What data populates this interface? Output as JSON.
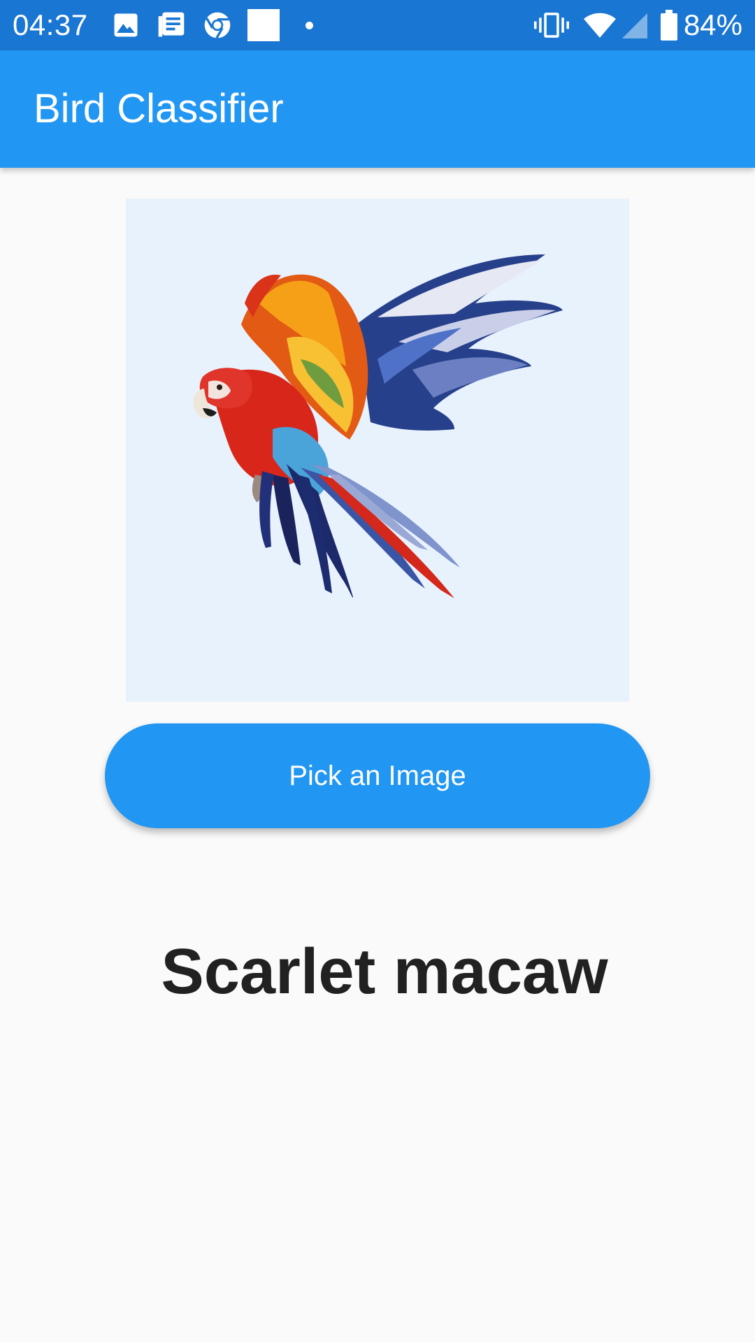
{
  "status_bar": {
    "time": "04:37",
    "battery_percent": "84%",
    "icons": [
      "image-icon",
      "news-icon",
      "chrome-icon",
      "square-notification-icon",
      "dot-icon",
      "vibrate-icon",
      "wifi-icon",
      "cell-signal-icon",
      "battery-icon"
    ],
    "color": "#1976d2"
  },
  "app_bar": {
    "title": "Bird Classifier",
    "color": "#2196f3"
  },
  "image": {
    "subject": "scarlet-macaw-photo",
    "background_color": "#e8f2fd"
  },
  "button": {
    "label": "Pick an Image",
    "color": "#2196f3"
  },
  "result": {
    "label": "Scarlet macaw"
  }
}
